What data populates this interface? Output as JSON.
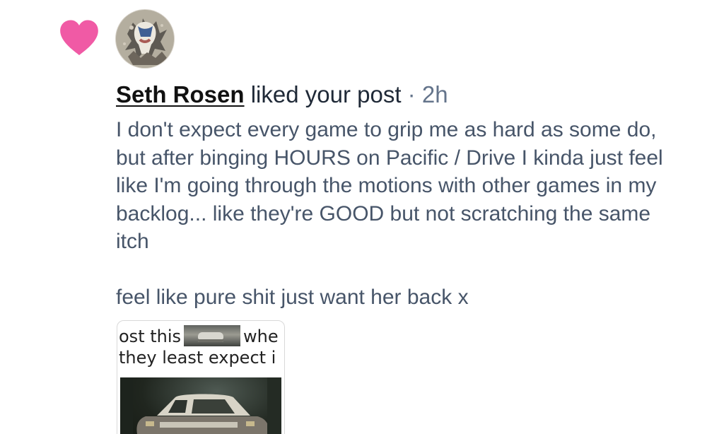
{
  "notification": {
    "icon": "heart-icon",
    "accent_color": "#f05aa5",
    "user": {
      "name": "Seth Rosen"
    },
    "action_text": "liked your post",
    "separator": "·",
    "time": "2h",
    "post": {
      "paragraph_1": "I don't expect every game to grip me as hard as some do, but after binging HOURS on Pacific / Drive I kinda just feel like I'm going through the motions with other games in my backlog... like they're GOOD but not scratching the same itch",
      "paragraph_2": "feel like pure shit just want her back x"
    },
    "meme": {
      "caption_line_1_part_1": "ost this",
      "caption_line_1_part_2": "whe",
      "caption_line_2": "they least expect i"
    }
  }
}
